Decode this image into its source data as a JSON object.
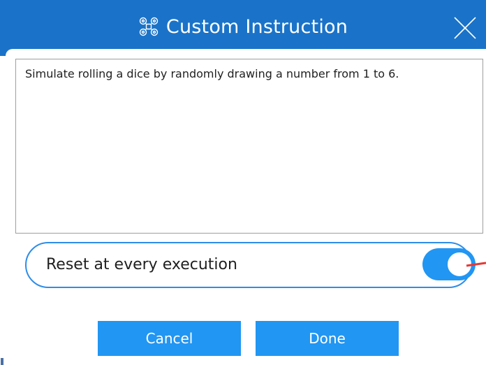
{
  "dialog": {
    "title": "Custom Instruction",
    "title_icon": "drone-icon",
    "close_icon": "close-icon"
  },
  "instruction": {
    "value": "Simulate rolling a dice by randomly drawing a number from 1 to 6."
  },
  "reset_option": {
    "label": "Reset at every execution",
    "enabled": true
  },
  "buttons": {
    "cancel_label": "Cancel",
    "done_label": "Done"
  },
  "colors": {
    "titlebar": "#1a73c8",
    "accent": "#2196f3",
    "annotation_pointer": "#e53935"
  }
}
